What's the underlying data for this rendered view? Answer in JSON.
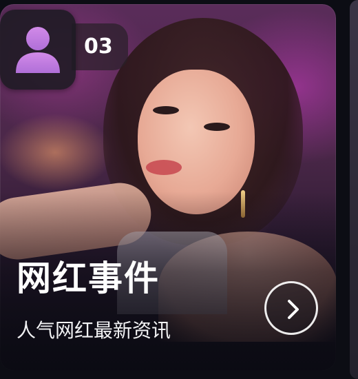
{
  "card": {
    "count": "03",
    "title": "网红事件",
    "subtitle": "人气网红最新资讯"
  },
  "icons": {
    "avatar": "person-icon",
    "arrow": "chevron-right-icon"
  },
  "colors": {
    "avatar_accent": "#c07be0",
    "background": "#0c0d14",
    "text": "#ffffff"
  }
}
